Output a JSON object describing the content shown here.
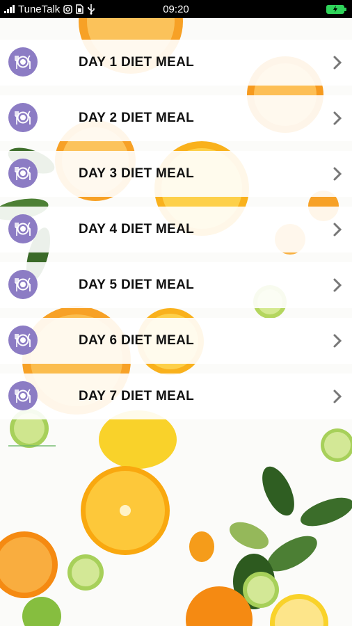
{
  "status_bar": {
    "carrier": "TuneTalk",
    "time": "09:20",
    "icons": [
      "signal-icon",
      "instagram-icon",
      "sim-icon",
      "usb-icon",
      "battery-charging-icon"
    ]
  },
  "list": {
    "items": [
      {
        "label": "DAY 1 DIET MEAL",
        "icon": "plate-cutlery-icon"
      },
      {
        "label": "DAY 2 DIET MEAL",
        "icon": "plate-cutlery-icon"
      },
      {
        "label": "DAY 3 DIET MEAL",
        "icon": "plate-cutlery-icon"
      },
      {
        "label": "DAY 4 DIET MEAL",
        "icon": "plate-cutlery-icon"
      },
      {
        "label": "DAY 5 DIET MEAL",
        "icon": "plate-cutlery-icon"
      },
      {
        "label": "DAY 6 DIET MEAL",
        "icon": "plate-cutlery-icon"
      },
      {
        "label": "DAY 7 DIET MEAL",
        "icon": "plate-cutlery-icon"
      }
    ]
  },
  "colors": {
    "icon_bg": "#8c7cc4",
    "battery": "#2fd35a",
    "orange": "#f7a126",
    "lemon": "#f9d22a",
    "lime": "#a7d05a",
    "leaf": "#3f6f2c"
  }
}
